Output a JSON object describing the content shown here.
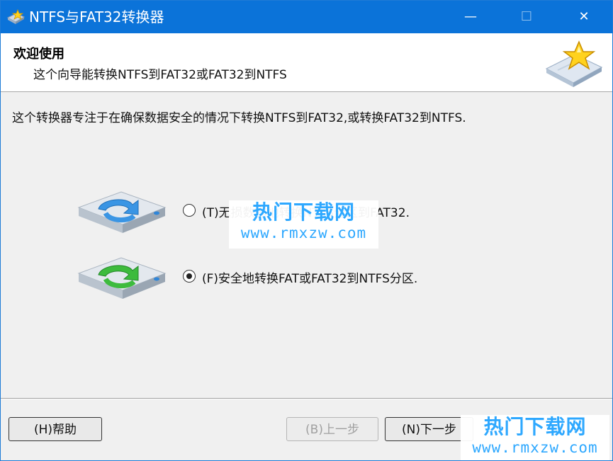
{
  "window": {
    "title": "NTFS与FAT32转换器",
    "minimize_glyph": "—",
    "maximize_glyph": "☐",
    "close_glyph": "✕"
  },
  "header": {
    "title": "欢迎使用",
    "subtitle": "这个向导能转换NTFS到FAT32或FAT32到NTFS"
  },
  "content": {
    "description": "这个转换器专注于在确保数据安全的情况下转换NTFS到FAT32,或转换FAT32到NTFS.",
    "options": [
      {
        "label": "(T)无损数据地转换NTFS分区到FAT32.",
        "selected": false,
        "icon": "disk-blue-arrow-icon"
      },
      {
        "label": "(F)安全地转换FAT或FAT32到NTFS分区.",
        "selected": true,
        "icon": "disk-green-arrow-icon"
      }
    ]
  },
  "buttons": {
    "help": "(H)帮助",
    "back": "(B)上一步",
    "next": "(N)下一步",
    "back_enabled": false
  },
  "watermark": {
    "cn": "热门下载网",
    "url": "www.rmxzw.com"
  },
  "colors": {
    "titlebar": "#0b73d9",
    "watermark": "#2ea8ff"
  }
}
